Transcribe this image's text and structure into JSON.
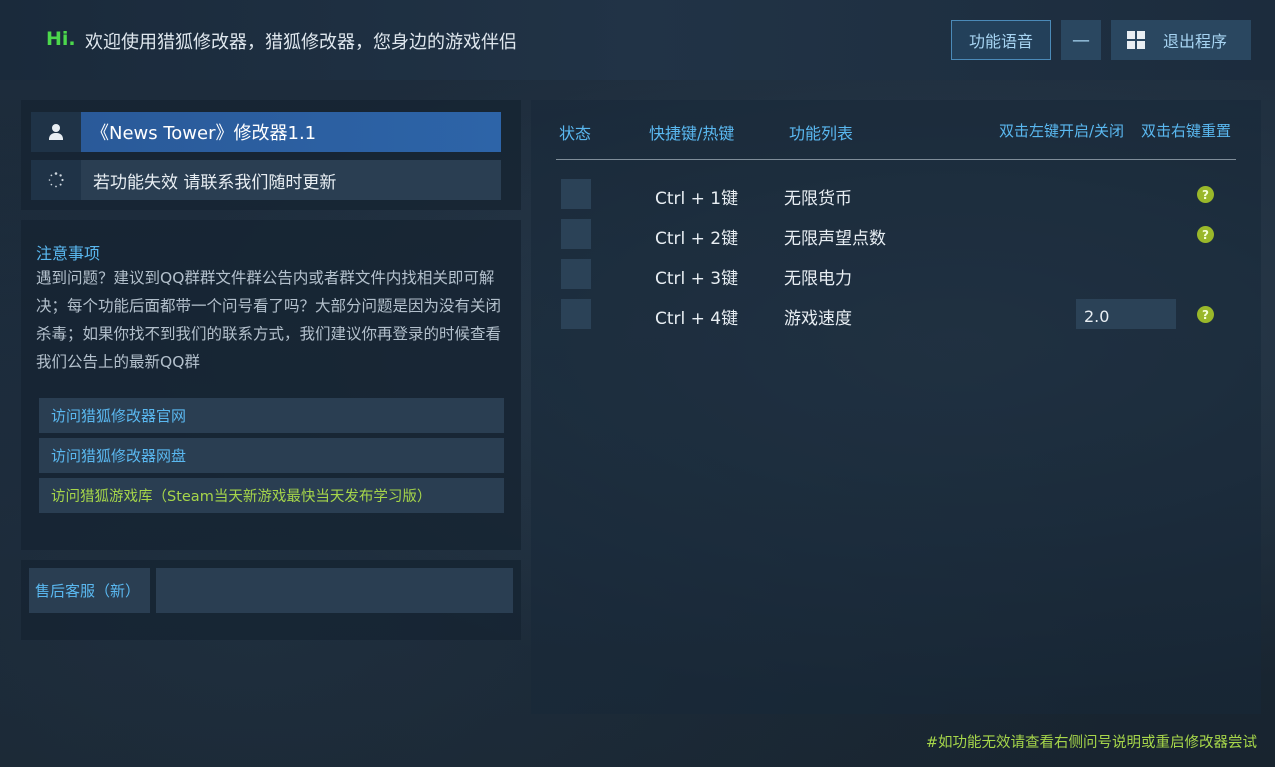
{
  "header": {
    "hi": "Hi.",
    "greeting": "欢迎使用猎狐修改器，猎狐修改器，您身边的游戏伴侣",
    "voice_button": "功能语音",
    "minimize_button": "—",
    "exit_button": "退出程序"
  },
  "game": {
    "title": "《News Tower》修改器1.1",
    "subtitle": "若功能失效 请联系我们随时更新"
  },
  "notes": {
    "title": "注意事项",
    "body": "遇到问题？建议到QQ群群文件群公告内或者群文件内找相关即可解决；每个功能后面都带一个问号看了吗？大部分问题是因为没有关闭杀毒；如果你找不到我们的联系方式，我们建议你再登录的时候查看我们公告上的最新QQ群"
  },
  "links": [
    {
      "label": "访问猎狐修改器官网"
    },
    {
      "label": "访问猎狐修改器网盘"
    },
    {
      "label": "访问猎狐游戏库（Steam当天新游戏最快当天发布学习版）"
    }
  ],
  "customer_service": {
    "label": "售后客服（新）"
  },
  "table": {
    "headers": {
      "status": "状态",
      "hotkey": "快捷键/热键",
      "function": "功能列表",
      "toggle_hint": "双击左键开启/关闭",
      "reset_hint": "双击右键重置"
    },
    "rows": [
      {
        "hotkey": "Ctrl + 1键",
        "function": "无限货币",
        "help": "?"
      },
      {
        "hotkey": "Ctrl + 2键",
        "function": "无限声望点数",
        "help": "?"
      },
      {
        "hotkey": "Ctrl + 3键",
        "function": "无限电力"
      },
      {
        "hotkey": "Ctrl + 4键",
        "function": "游戏速度",
        "value": "2.0",
        "help": "?"
      }
    ]
  },
  "footer": {
    "note": "#如功能无效请查看右侧问号说明或重启修改器尝试"
  },
  "colors": {
    "accent_blue": "#5ab8f0",
    "accent_green": "#a6d64a",
    "title_bar": "#2a5a99"
  }
}
